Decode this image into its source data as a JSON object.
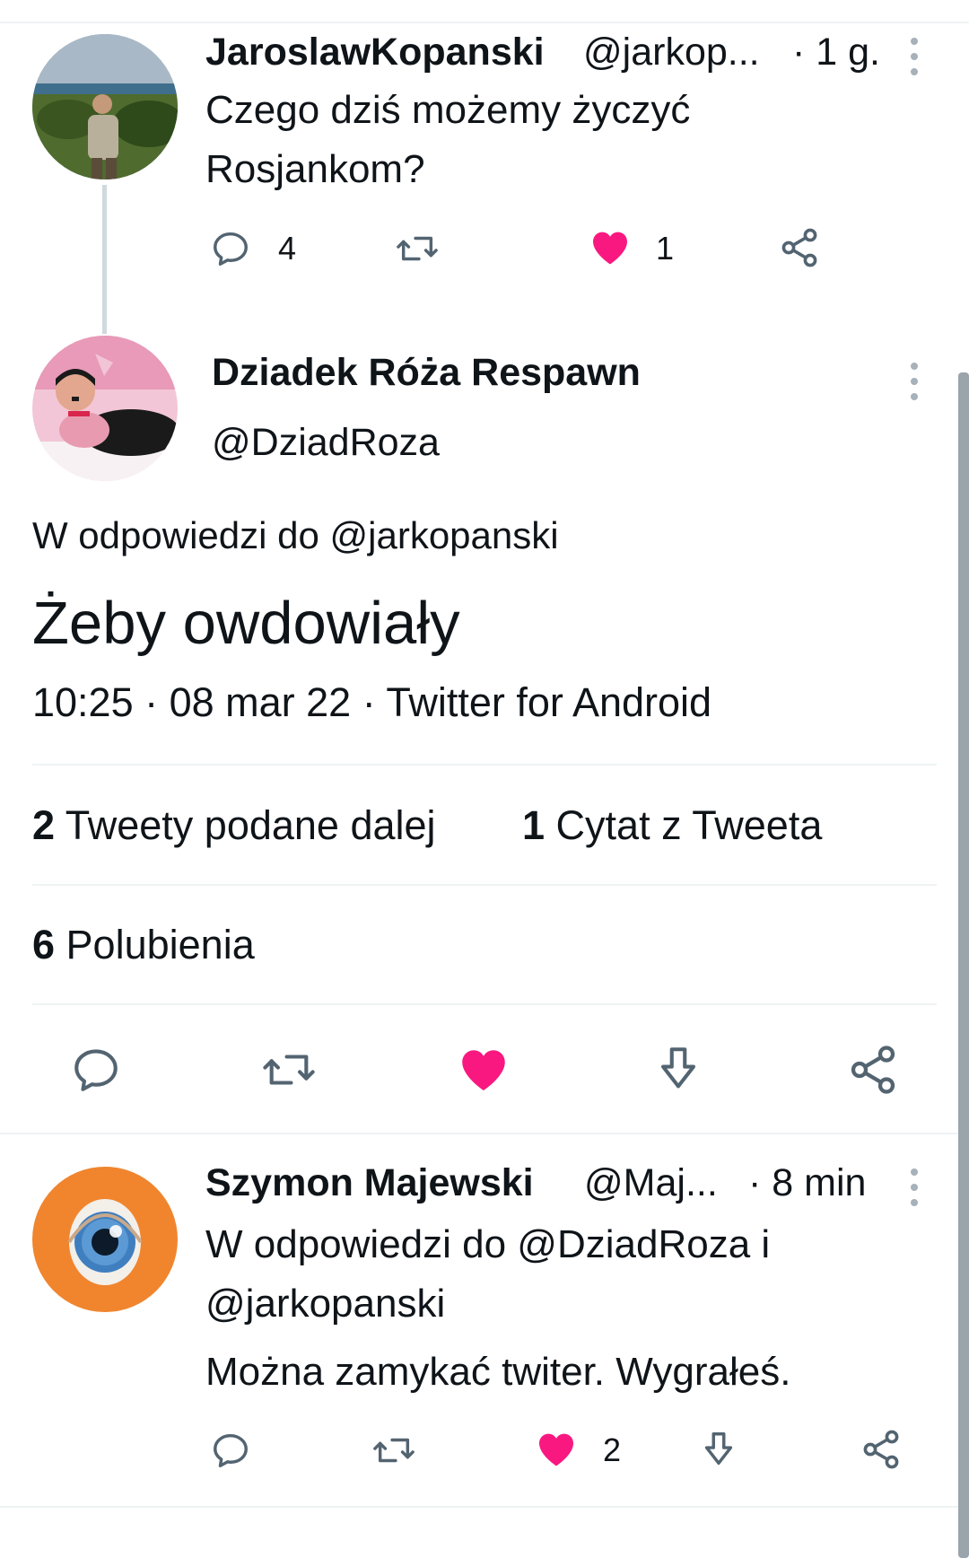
{
  "colors": {
    "like": "#f91880",
    "icon": "#536471",
    "text": "#0f1419",
    "divider": "#eff3f4"
  },
  "tweet1": {
    "author_name": "JaroslawKopanski",
    "author_handle": "@jarkop...",
    "time": "· 1 g.",
    "text_line1": "Czego dziś możemy życzyć",
    "text_line2": "Rosjankom?",
    "reply_count": "4",
    "like_count": "1",
    "liked": true
  },
  "main_tweet": {
    "author_name": "Dziadek Róża Respawn",
    "author_handle": "@DziadRoza",
    "reply_to": "W odpowiedzi do @jarkopanski",
    "text": "Żeby owdowiały",
    "timestamp": "10:25 · 08 mar 22 · Twitter for Android",
    "retweets_count": "2",
    "retweets_label": "Tweety podane dalej",
    "quotes_count": "1",
    "quotes_label": "Cytat z Tweeta",
    "likes_count": "6",
    "likes_label": "Polubienia",
    "liked": true
  },
  "tweet2": {
    "author_name": "Szymon Majewski",
    "author_handle": "@Maj...",
    "time": "· 8 min",
    "reply_line1": "W odpowiedzi do @DziadRoza i",
    "reply_line2": "@jarkopanski",
    "text": "Można zamykać twiter. Wygrałeś.",
    "like_count": "2",
    "liked": true
  },
  "icons": [
    "reply-icon",
    "retweet-icon",
    "like-icon",
    "bookmark-download-icon",
    "share-icon",
    "more-options-icon"
  ]
}
